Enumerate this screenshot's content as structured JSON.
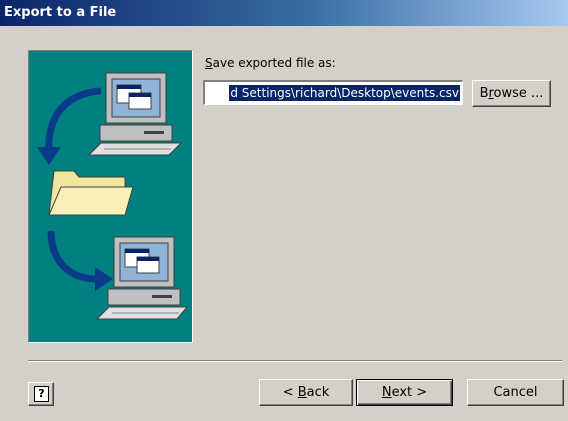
{
  "window": {
    "title": "Export to a File"
  },
  "form": {
    "save_label_mnemonic": "S",
    "save_label_rest": "ave exported file as:",
    "file_path": "d Settings\\richard\\Desktop\\events.csv"
  },
  "buttons": {
    "browse_pre": "B",
    "browse_mn": "r",
    "browse_post": "owse ...",
    "back_pre": "< ",
    "back_mn": "B",
    "back_post": "ack",
    "next_mn": "N",
    "next_post": "ext >",
    "cancel": "Cancel",
    "help_glyph": "?"
  },
  "icons": [
    "computer-icon",
    "folder-icon",
    "arrow-icon",
    "help-icon"
  ],
  "colors": {
    "illustration_bg": "#008080",
    "selection": "#0a246a",
    "titlebar_start": "#0a246a"
  }
}
